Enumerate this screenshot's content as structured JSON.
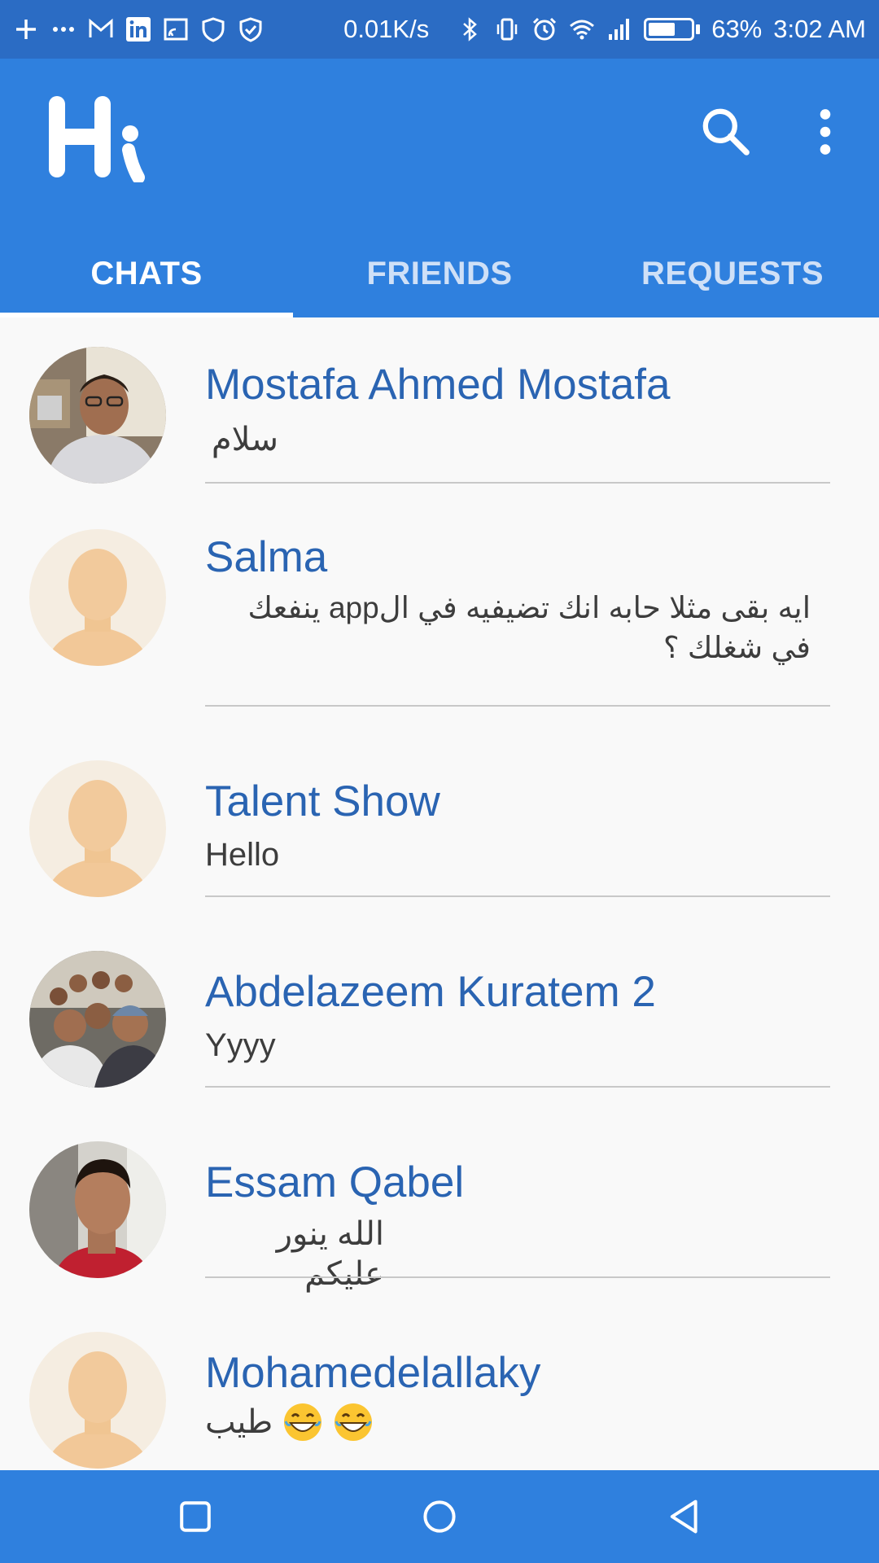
{
  "status_bar": {
    "network_speed": "0.01K/s",
    "battery_percent": "63%",
    "battery_level": 0.63,
    "time": "3:02 AM",
    "left_icons": [
      "plus-icon",
      "more-dots-icon",
      "gmail-icon",
      "linkedin-icon",
      "cast-icon",
      "shield-icon",
      "shield-check-icon"
    ],
    "right_icons": [
      "bluetooth-icon",
      "vibrate-icon",
      "alarm-icon",
      "wifi-icon",
      "signal-icon",
      "battery-icon"
    ]
  },
  "app_bar": {
    "logo_text": "Hi",
    "actions": [
      "search-icon",
      "more-vert-icon"
    ],
    "color": "#2f80de"
  },
  "tabs": [
    {
      "label": "CHATS",
      "active": true
    },
    {
      "label": "FRIENDS",
      "active": false
    },
    {
      "label": "REQUESTS",
      "active": false
    }
  ],
  "chats": [
    {
      "name": "Mostafa Ahmed Mostafa",
      "message": "سلام",
      "avatar": "photo"
    },
    {
      "name": "Salma",
      "message": "ايه بقى مثلا حابه انك تضيفيه في الapp ينفعك في شغلك ؟",
      "avatar": "default"
    },
    {
      "name": "Talent Show",
      "message": "Hello",
      "avatar": "default"
    },
    {
      "name": "Abdelazeem Kuratem 2",
      "message": "Yyyy",
      "avatar": "group-photo"
    },
    {
      "name": "Essam Qabel",
      "message": "الله ينور عليكم",
      "avatar": "photo"
    },
    {
      "name": "Mohamedelallaky",
      "message": "طيب",
      "message_emojis": [
        "grinning-face-emoji",
        "grinning-face-emoji"
      ],
      "avatar": "default"
    }
  ],
  "nav_bar": {
    "buttons": [
      "recents-square-icon",
      "home-circle-icon",
      "back-triangle-icon"
    ]
  },
  "colors": {
    "status_bar": "#2b6cc4",
    "accent": "#2f80de",
    "name_text": "#2a64b2"
  }
}
